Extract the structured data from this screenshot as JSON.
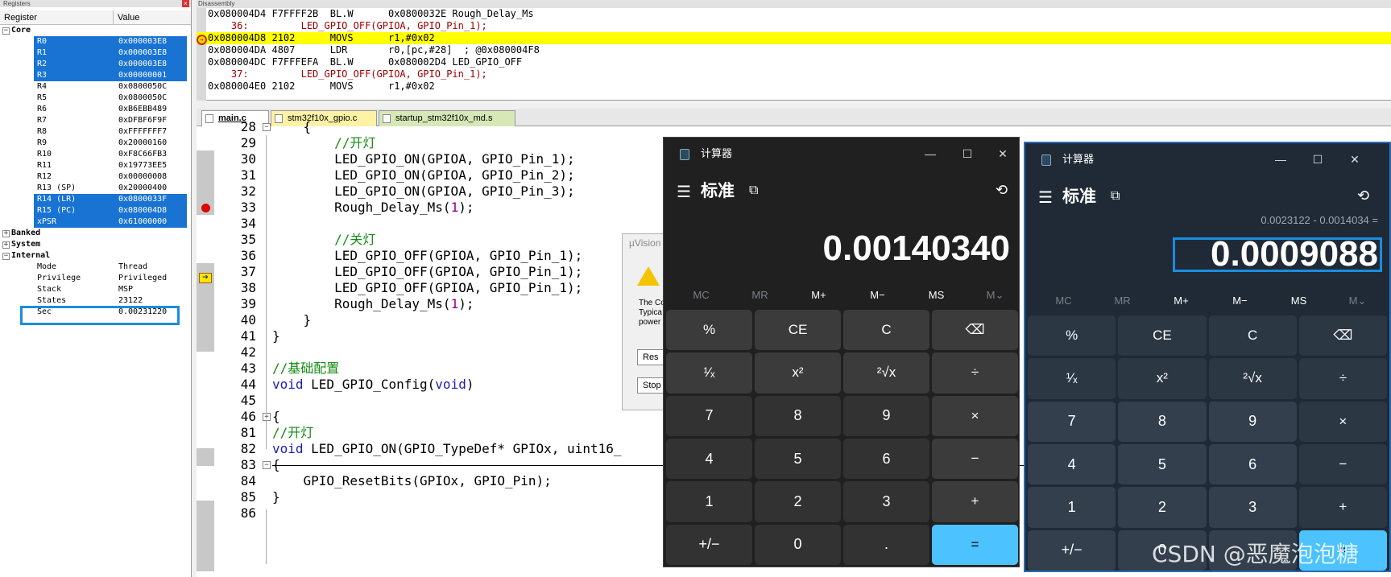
{
  "registers": {
    "pane_title": "Registers",
    "col_register": "Register",
    "col_value": "Value",
    "groups": {
      "core": "Core",
      "banked": "Banked",
      "system": "System",
      "internal": "Internal"
    },
    "core": [
      {
        "name": "R0",
        "value": "0x000003E8"
      },
      {
        "name": "R1",
        "value": "0x000003E8"
      },
      {
        "name": "R2",
        "value": "0x000003E8"
      },
      {
        "name": "R3",
        "value": "0x00000001"
      },
      {
        "name": "R4",
        "value": "0x0800050C"
      },
      {
        "name": "R5",
        "value": "0x0800050C"
      },
      {
        "name": "R6",
        "value": "0xB6EBB489"
      },
      {
        "name": "R7",
        "value": "0xDFBF6F9F"
      },
      {
        "name": "R8",
        "value": "0xFFFFFFF7"
      },
      {
        "name": "R9",
        "value": "0x20000160"
      },
      {
        "name": "R10",
        "value": "0xF8C66FB3"
      },
      {
        "name": "R11",
        "value": "0x19773EE5"
      },
      {
        "name": "R12",
        "value": "0x00000008"
      },
      {
        "name": "R13 (SP)",
        "value": "0x20000400"
      },
      {
        "name": "R14 (LR)",
        "value": "0x0800033F"
      },
      {
        "name": "R15 (PC)",
        "value": "0x080004D8"
      },
      {
        "name": "xPSR",
        "value": "0x61000000"
      }
    ],
    "internal": [
      {
        "name": "Mode",
        "value": "Thread"
      },
      {
        "name": "Privilege",
        "value": "Privileged"
      },
      {
        "name": "Stack",
        "value": "MSP"
      },
      {
        "name": "States",
        "value": "23122"
      },
      {
        "name": "Sec",
        "value": "0.00231220"
      }
    ]
  },
  "disassembly": {
    "title": "Disassembly",
    "lines": [
      "0x080004D4 F7FFFF2B  BL.W      0x0800032E Rough_Delay_Ms",
      "    36:         LED_GPIO_OFF(GPIOA, GPIO_Pin_1);",
      "0x080004D8 2102      MOVS      r1,#0x02",
      "0x080004DA 4807      LDR       r0,[pc,#28]  ; @0x080004F8",
      "0x080004DC F7FFFEFA  BL.W      0x080002D4 LED_GPIO_OFF",
      "    37:         LED_GPIO_OFF(GPIOA, GPIO_Pin_1);",
      "0x080004E0 2102      MOVS      r1,#0x02"
    ]
  },
  "tabs": [
    "main.c",
    "stm32f10x_gpio.c",
    "startup_stm32f10x_md.s"
  ],
  "code": [
    {
      "ln": "28",
      "text": "    {"
    },
    {
      "ln": "29",
      "text": "        //开灯"
    },
    {
      "ln": "30",
      "text": "        LED_GPIO_ON(GPIOA, GPIO_Pin_1);"
    },
    {
      "ln": "31",
      "text": "        LED_GPIO_ON(GPIOA, GPIO_Pin_2);"
    },
    {
      "ln": "32",
      "text": "        LED_GPIO_ON(GPIOA, GPIO_Pin_3);"
    },
    {
      "ln": "33",
      "text": "        Rough_Delay_Ms(1);"
    },
    {
      "ln": "34",
      "text": ""
    },
    {
      "ln": "35",
      "text": "        //关灯"
    },
    {
      "ln": "36",
      "text": "        LED_GPIO_OFF(GPIOA, GPIO_Pin_1);"
    },
    {
      "ln": "37",
      "text": "        LED_GPIO_OFF(GPIOA, GPIO_Pin_1);"
    },
    {
      "ln": "38",
      "text": "        LED_GPIO_OFF(GPIOA, GPIO_Pin_1);"
    },
    {
      "ln": "39",
      "text": "        Rough_Delay_Ms(1);"
    },
    {
      "ln": "40",
      "text": "    }"
    },
    {
      "ln": "41",
      "text": "}"
    },
    {
      "ln": "42",
      "text": ""
    },
    {
      "ln": "43",
      "text": "//基础配置"
    },
    {
      "ln": "44",
      "text": "void LED_GPIO_Config(void)"
    },
    {
      "ln": "45",
      "text": ""
    },
    {
      "ln": "46",
      "text": "{"
    },
    {
      "ln": "81",
      "text": "//开灯"
    },
    {
      "ln": "82",
      "text": "void LED_GPIO_ON(GPIO_TypeDef* GPIOx, uint16_"
    },
    {
      "ln": "83",
      "text": "{"
    },
    {
      "ln": "84",
      "text": "    GPIO_ResetBits(GPIOx, GPIO_Pin);"
    },
    {
      "ln": "85",
      "text": "}"
    },
    {
      "ln": "86",
      "text": ""
    }
  ],
  "uvision": {
    "title": "µVision",
    "text": "The Co\nTypica\npower",
    "btn_reset": "Res",
    "btn_stop": "Stop"
  },
  "calc_left": {
    "app": "计算器",
    "mode": "标准",
    "display": "0.00140340",
    "memory": [
      "MC",
      "MR",
      "M+",
      "M−",
      "MS",
      "M⌄"
    ],
    "keys": [
      "%",
      "CE",
      "C",
      "⌫",
      "¹⁄ₓ",
      "x²",
      "²√x",
      "÷",
      "7",
      "8",
      "9",
      "×",
      "4",
      "5",
      "6",
      "−",
      "1",
      "2",
      "3",
      "+",
      "+/−",
      "0",
      ".",
      "="
    ]
  },
  "calc_right": {
    "app": "计算器",
    "mode": "标准",
    "expression": "0.0023122 - 0.0014034 =",
    "display": "0.0009088",
    "memory": [
      "MC",
      "MR",
      "M+",
      "M−",
      "MS",
      "M⌄"
    ],
    "keys": [
      "%",
      "CE",
      "C",
      "⌫",
      "¹⁄ₓ",
      "x²",
      "²√x",
      "÷",
      "7",
      "8",
      "9",
      "×",
      "4",
      "5",
      "6",
      "−",
      "1",
      "2",
      "3",
      "+",
      "+/−",
      "0",
      ".",
      "="
    ]
  },
  "watermark": "CSDN @恶魔泡泡糖",
  "colors": {
    "selection": "#1873d3",
    "highlight_box": "#1a8ddf",
    "current_line": "#ffff00",
    "equals_key": "#4cc2ff"
  }
}
